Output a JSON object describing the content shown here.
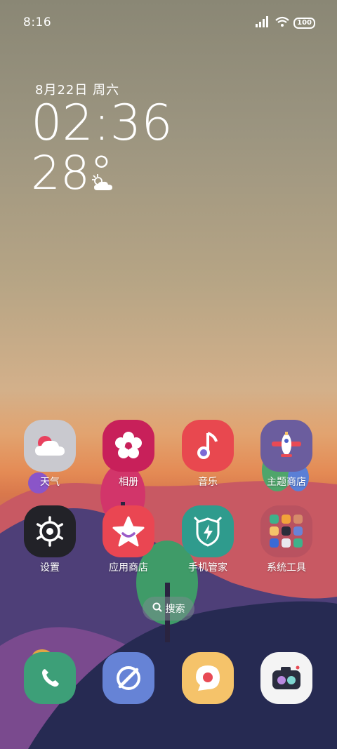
{
  "status_bar": {
    "time": "8:16",
    "battery": "100"
  },
  "clock_widget": {
    "date": "8月22日 周六",
    "time": "02:36",
    "temperature": "28°"
  },
  "apps": [
    {
      "label": "天气",
      "icon": "weather-icon"
    },
    {
      "label": "相册",
      "icon": "flower-icon"
    },
    {
      "label": "音乐",
      "icon": "music-note-icon"
    },
    {
      "label": "主题商店",
      "icon": "airplane-icon"
    },
    {
      "label": "设置",
      "icon": "gear-icon"
    },
    {
      "label": "应用商店",
      "icon": "star-icon"
    },
    {
      "label": "手机管家",
      "icon": "shield-icon"
    },
    {
      "label": "系统工具",
      "icon": "folder-icon"
    }
  ],
  "search": {
    "label": "搜索"
  },
  "dock": [
    {
      "icon": "phone-icon"
    },
    {
      "icon": "browser-icon"
    },
    {
      "icon": "message-icon"
    },
    {
      "icon": "camera-icon"
    }
  ],
  "colors": {
    "weather": "#c9c9cf",
    "gallery": "#c8205a",
    "music": "#e8484f",
    "theme": "#6b5d9e",
    "settings": "#222228",
    "appstore": "#ea4652",
    "security": "#2f9b8d",
    "tools": "#b95260",
    "phone": "#3d9f78",
    "browser": "#6683d6",
    "messages": "#f5c36a",
    "camera": "#f4f4f4"
  }
}
